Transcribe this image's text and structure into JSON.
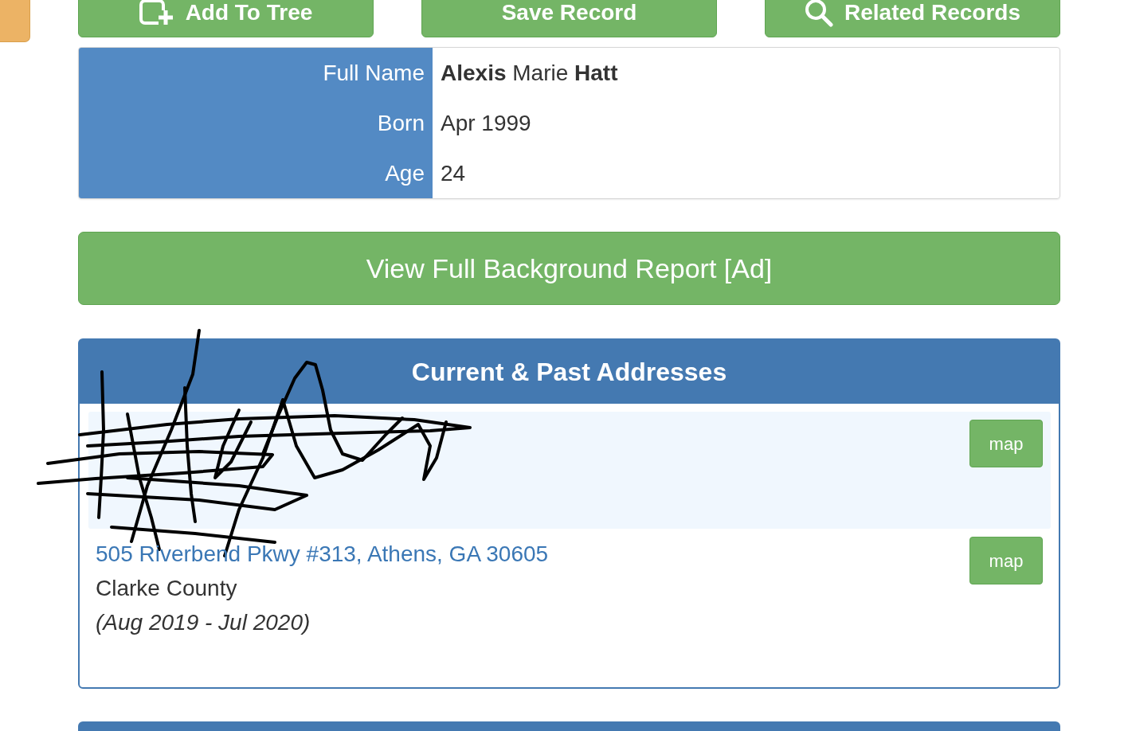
{
  "action_buttons": [
    {
      "kind": "add",
      "label": "Add To Tree"
    },
    {
      "kind": "save",
      "label": "Save Record"
    },
    {
      "kind": "related",
      "label": "Related Records"
    }
  ],
  "person": {
    "rows": [
      {
        "label": "Full Name",
        "value": "**Alexis** Marie **Hatt**"
      },
      {
        "label": "Born",
        "value": "Apr 1999"
      },
      {
        "label": "Age",
        "value": "24"
      }
    ]
  },
  "report_button": {
    "label": "View Full Background Report [Ad]"
  },
  "addresses": {
    "title": "Current & Past Addresses",
    "items": [
      {
        "highlighted": true,
        "redacted": true,
        "map_button": "map"
      },
      {
        "highlighted": false,
        "redacted": false,
        "address": "505 Riverbend Pkwy #313, Athens, GA 30605",
        "county": "Clarke County",
        "period": "(Aug 2019 - Jul 2020)",
        "map_button": "map"
      }
    ]
  }
}
